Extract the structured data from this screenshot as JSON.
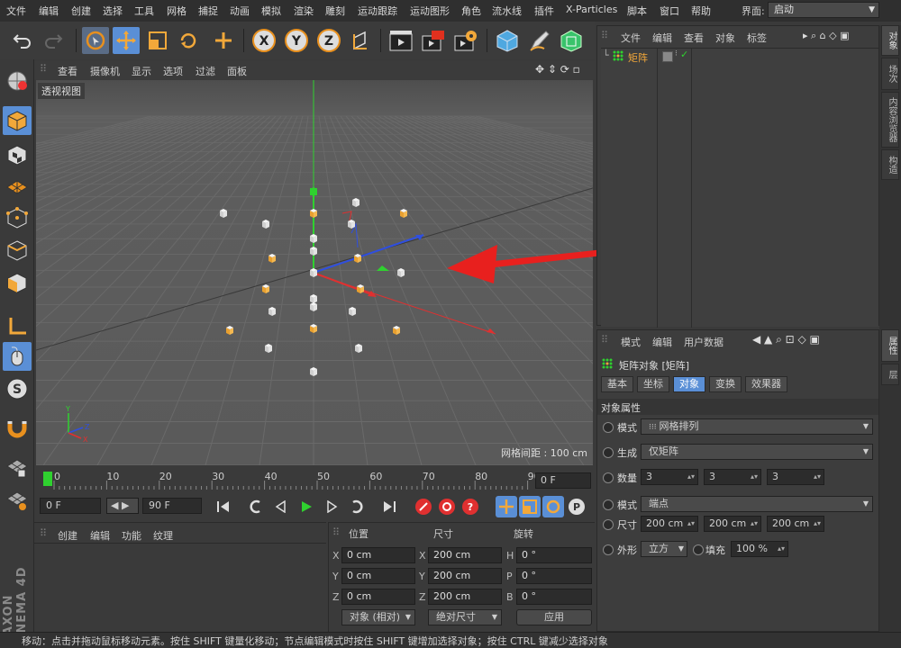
{
  "menubar": {
    "items": [
      "文件",
      "编辑",
      "创建",
      "选择",
      "工具",
      "网格",
      "捕捉",
      "动画",
      "模拟",
      "渲染",
      "雕刻",
      "运动跟踪",
      "运动图形",
      "角色",
      "流水线",
      "插件",
      "X-Particles",
      "脚本",
      "窗口",
      "帮助"
    ],
    "layout_label": "界面:",
    "layout_value": "启动"
  },
  "toolbar": {
    "icons": [
      "undo-icon",
      "redo-icon",
      "live-select-icon",
      "move-icon",
      "scale-icon",
      "rotate-icon",
      "add-icon",
      "x-axis-icon",
      "y-axis-icon",
      "z-axis-icon",
      "coordinate-system-icon",
      "render-view-icon",
      "render-picture-viewer-icon",
      "render-settings-icon",
      "cube-icon",
      "pen-icon",
      "subdivision-icon"
    ],
    "x_label": "X",
    "y_label": "Y",
    "z_label": "Z"
  },
  "viewport": {
    "menus": [
      "查看",
      "摄像机",
      "显示",
      "选项",
      "过滤",
      "面板"
    ],
    "label": "透视视图",
    "grid_spacing": "网格间距 : 100 cm"
  },
  "timeline": {
    "ticks": [
      "0",
      "10",
      "20",
      "30",
      "40",
      "50",
      "60",
      "70",
      "80",
      "90"
    ],
    "current_frame": "0 F"
  },
  "playback": {
    "start_frame": "0 F",
    "end_frame": "90 F"
  },
  "material_manager": {
    "menus": [
      "创建",
      "编辑",
      "功能",
      "纹理"
    ]
  },
  "coordinates": {
    "position_header": "位置",
    "size_header": "尺寸",
    "rotation_header": "旋转",
    "position": [
      {
        "axis": "X",
        "value": "0 cm"
      },
      {
        "axis": "Y",
        "value": "0 cm"
      },
      {
        "axis": "Z",
        "value": "0 cm"
      }
    ],
    "size": [
      {
        "axis": "X",
        "value": "200 cm"
      },
      {
        "axis": "Y",
        "value": "200 cm"
      },
      {
        "axis": "Z",
        "value": "200 cm"
      }
    ],
    "rotation": [
      {
        "axis": "H",
        "value": "0 °"
      },
      {
        "axis": "P",
        "value": "0 °"
      },
      {
        "axis": "B",
        "value": "0 °"
      }
    ],
    "mode_dropdown": "对象 (相对)",
    "size_dropdown": "绝对尺寸",
    "apply_button": "应用"
  },
  "object_manager": {
    "menus": [
      "文件",
      "编辑",
      "查看",
      "对象",
      "标签"
    ],
    "objects": [
      {
        "name": "矩阵"
      }
    ]
  },
  "attribute_manager": {
    "menus": [
      "模式",
      "编辑",
      "用户数据"
    ],
    "object_title": "矩阵对象 [矩阵]",
    "tabs": [
      "基本",
      "坐标",
      "对象",
      "变换",
      "效果器"
    ],
    "active_tab": "对象",
    "section_title": "对象属性",
    "mode_label": "模式",
    "mode_value": "网格排列",
    "generate_label": "生成",
    "generate_value": "仅矩阵",
    "count_label": "数量",
    "count_values": [
      "3",
      "3",
      "3"
    ],
    "mode2_label": "模式",
    "mode2_value": "端点",
    "size_label": "尺寸",
    "size_values": [
      "200 cm",
      "200 cm",
      "200 cm"
    ],
    "shape_label": "外形",
    "shape_value": "立方",
    "fill_label": "填充",
    "fill_value": "100 %"
  },
  "right_tabs": [
    "对象",
    "场次",
    "内容浏览器",
    "构造",
    "属性",
    "层"
  ],
  "logo": {
    "text": "MAXON CINEMA 4D"
  },
  "statusbar": {
    "text": "移动：点击并拖动鼠标移动元素。按住 SHIFT 键量化移动；节点编辑模式时按住 SHIFT 键增加选择对象；按住 CTRL 键减少选择对象"
  },
  "colors": {
    "accent_blue": "#5a8fd6",
    "arrow_red": "#e8201e",
    "axis_green": "#2fd12f",
    "axis_blue": "#2f4fe0",
    "axis_red": "#e03030",
    "orange": "#f0a030"
  }
}
